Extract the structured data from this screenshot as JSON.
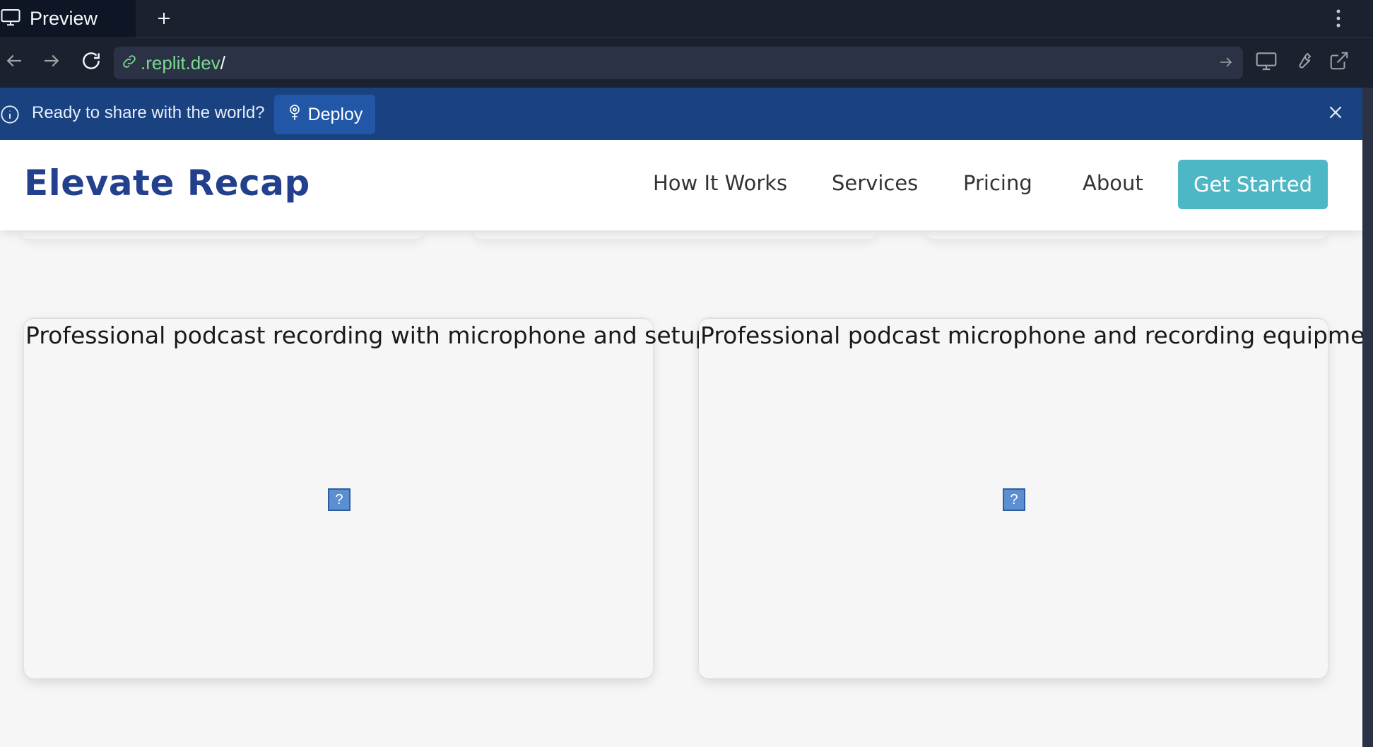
{
  "browser": {
    "tab": {
      "label": "Preview",
      "icon": "monitor-icon"
    },
    "new_tab_icon": "plus-icon",
    "menu_icon": "kebab-icon",
    "url": {
      "domain": ".replit.dev",
      "path": "/"
    },
    "nav_icons": [
      "arrow-left-icon",
      "arrow-right-icon",
      "reload-icon"
    ],
    "tool_icons": [
      "monitor-icon",
      "wrench-icon",
      "external-link-icon"
    ]
  },
  "banner": {
    "message": "Ready to share with the world?",
    "deploy_label": "Deploy",
    "colors": {
      "background": "#1a4281",
      "button": "#2257a8"
    }
  },
  "site": {
    "brand": "Elevate Recap",
    "nav": [
      "How It Works",
      "Services",
      "Pricing",
      "About"
    ],
    "cta_label": "Get Started",
    "colors": {
      "brand": "#23408e",
      "cta": "#4db7c5",
      "page_bg": "#f6f6f6"
    },
    "cards": [
      {
        "alt_text": "Professional podcast recording with microphone and setup",
        "broken_image_glyph": "?"
      },
      {
        "alt_text": "Professional podcast microphone and recording equipment",
        "broken_image_glyph": "?"
      }
    ]
  }
}
